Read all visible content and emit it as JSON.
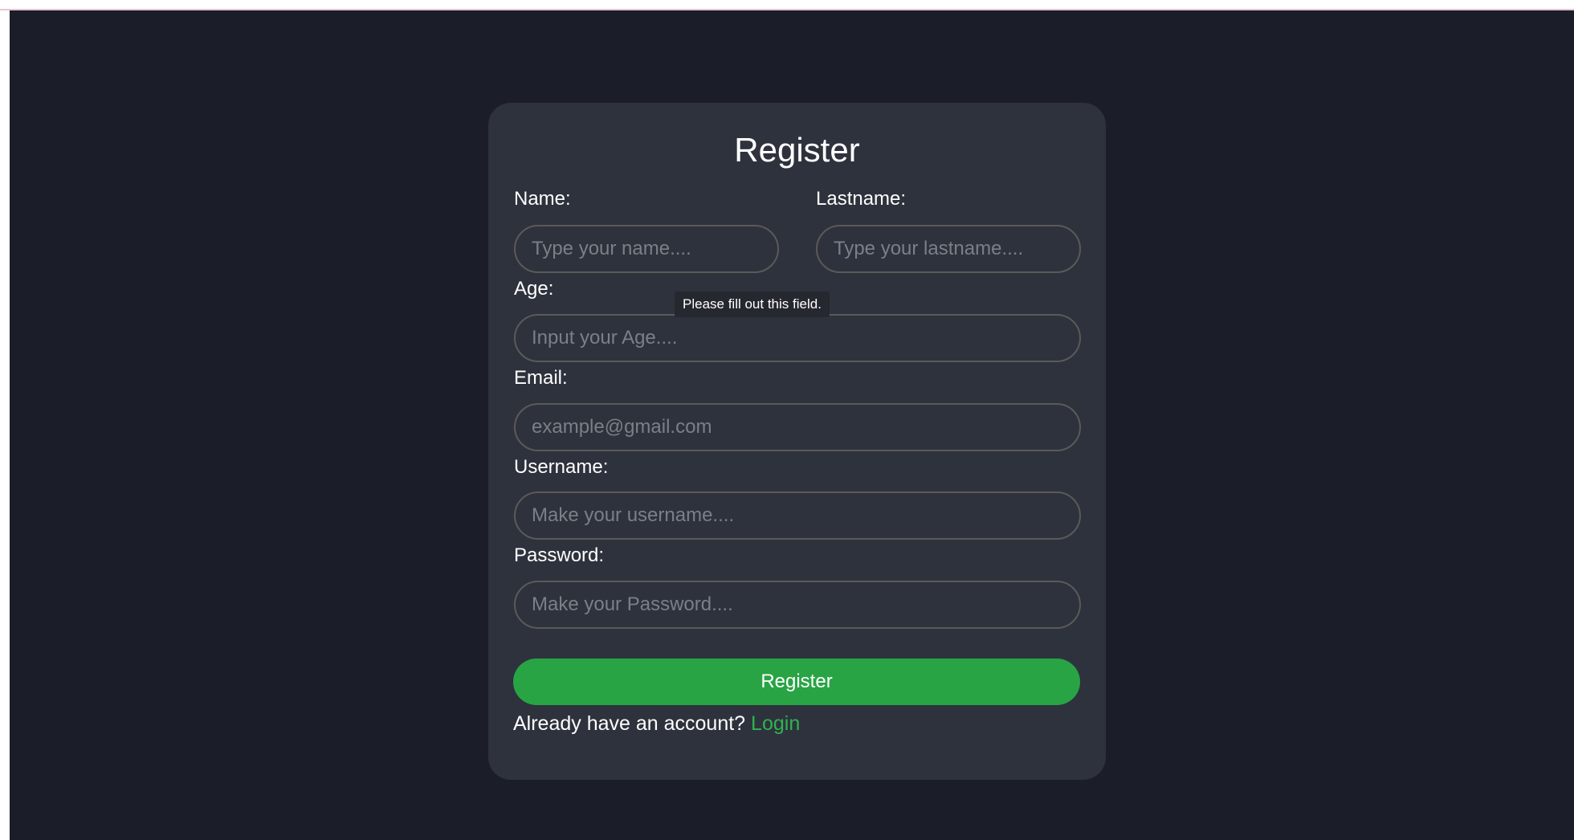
{
  "form": {
    "title": "Register",
    "fields": {
      "name": {
        "label": "Name:",
        "placeholder": "Type your name...."
      },
      "lastname": {
        "label": "Lastname:",
        "placeholder": "Type your lastname...."
      },
      "age": {
        "label": "Age:",
        "placeholder": "Input your Age...."
      },
      "email": {
        "label": "Email:",
        "placeholder": "example@gmail.com"
      },
      "username": {
        "label": "Username:",
        "placeholder": "Make your username...."
      },
      "password": {
        "label": "Password:",
        "placeholder": "Make your Password...."
      }
    },
    "validation_tooltip": "Please fill out this field.",
    "submit_label": "Register",
    "footer": {
      "prompt": "Already have an account?",
      "link_label": "Login"
    }
  },
  "colors": {
    "background": "#1b1e28",
    "card": "#2e323d",
    "accent": "#28a445",
    "link": "#2fb34f",
    "field_border": "#5b5a58"
  }
}
